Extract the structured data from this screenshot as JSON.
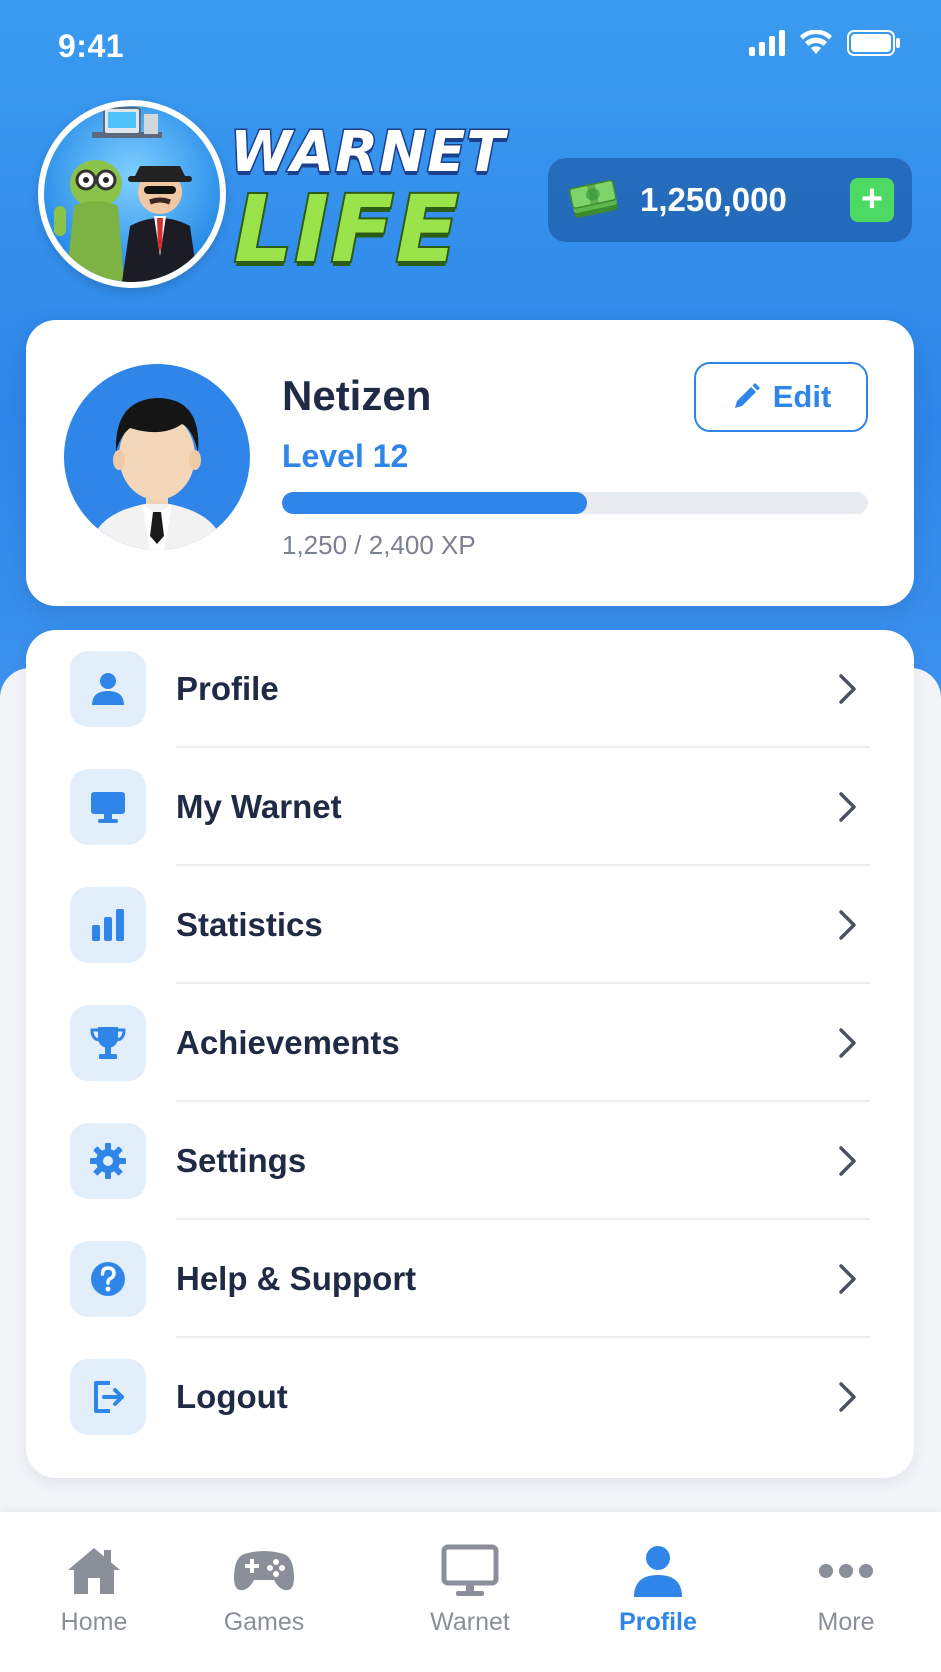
{
  "status_bar": {
    "time": "9:41"
  },
  "logo": {
    "line1": "WARNET",
    "line2": "LIFE"
  },
  "wallet": {
    "amount": "1,250,000",
    "add_label": "+"
  },
  "profile": {
    "name": "Netizen",
    "level": "Level 12",
    "xp_text": "1,250 / 2,400 XP",
    "xp_fraction": 0.52,
    "edit_label": "Edit"
  },
  "menu": {
    "items": [
      {
        "label": "Profile",
        "icon": "person-icon"
      },
      {
        "label": "My Warnet",
        "icon": "monitor-icon"
      },
      {
        "label": "Statistics",
        "icon": "bar-chart-icon"
      },
      {
        "label": "Achievements",
        "icon": "trophy-icon"
      },
      {
        "label": "Settings",
        "icon": "gear-icon"
      },
      {
        "label": "Help & Support",
        "icon": "help-icon"
      },
      {
        "label": "Logout",
        "icon": "logout-icon"
      }
    ]
  },
  "nav": {
    "items": [
      {
        "label": "Home",
        "icon": "home-icon",
        "active": false
      },
      {
        "label": "Games",
        "icon": "gamepad-icon",
        "active": false
      },
      {
        "label": "Warnet",
        "icon": "monitor-icon",
        "active": false
      },
      {
        "label": "Profile",
        "icon": "person-icon",
        "active": true
      },
      {
        "label": "More",
        "icon": "more-icon",
        "active": false
      }
    ]
  },
  "colors": {
    "primary": "#2f86e8",
    "accent_green": "#4cd964",
    "text_dark": "#1f2a44",
    "text_muted": "#7a8190",
    "icon_bg": "#e3eefb"
  }
}
